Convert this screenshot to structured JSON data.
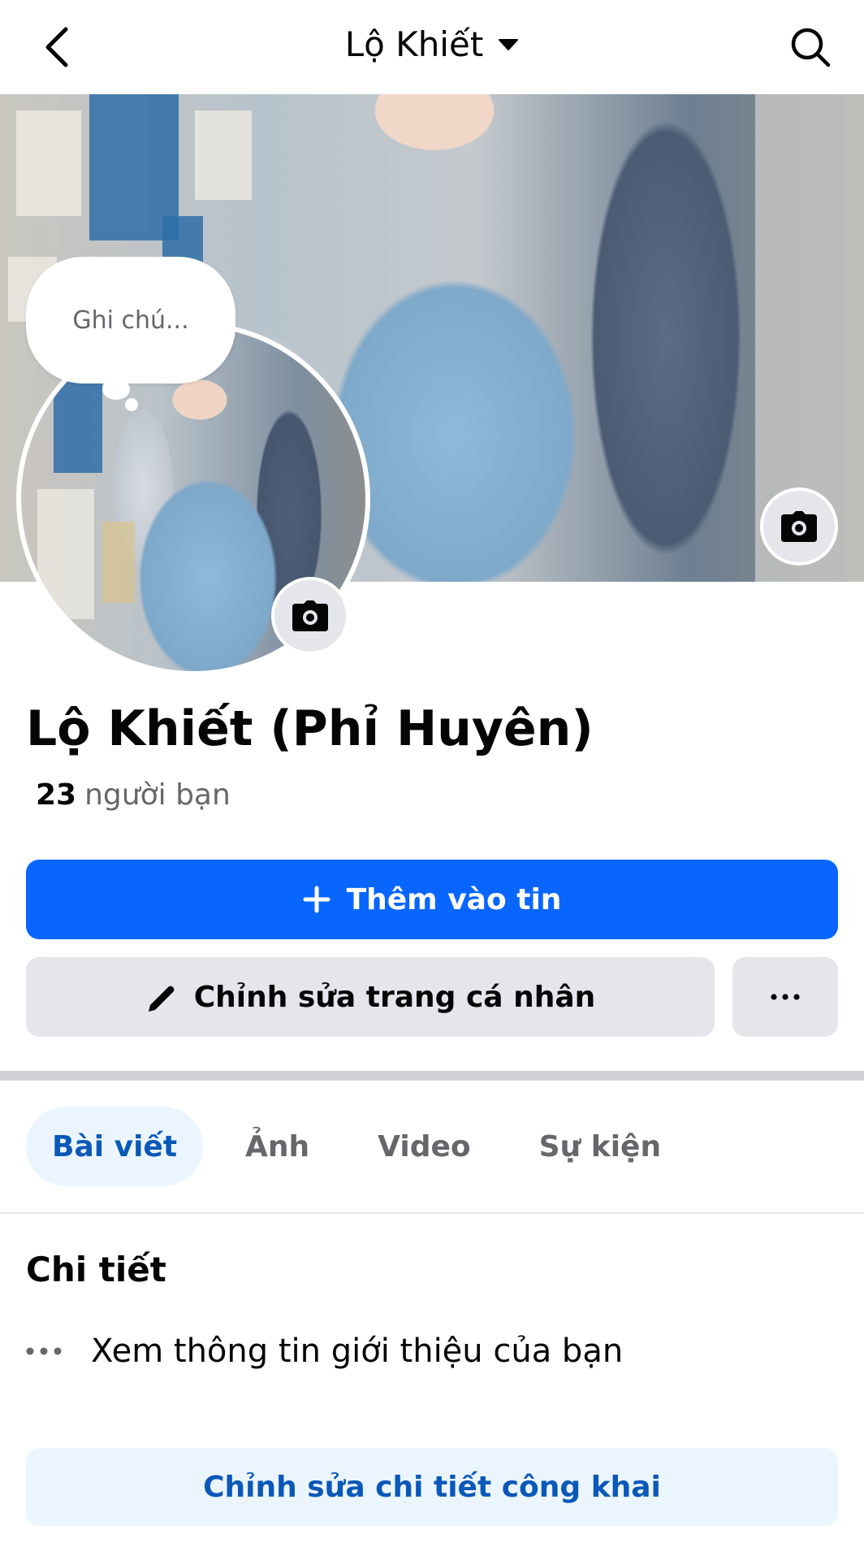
{
  "header": {
    "title": "Lộ Khiết",
    "icons": {
      "back": "chevron-left-icon",
      "dropdown": "caret-down-icon",
      "search": "search-icon"
    }
  },
  "note": {
    "placeholder": "Ghi chú..."
  },
  "profile": {
    "name": "Lộ Khiết (Phỉ Huyên)",
    "friend_count": "23",
    "friend_label": "người bạn"
  },
  "actions": {
    "add_story": "Thêm vào tin",
    "edit_profile": "Chỉnh sửa trang cá nhân",
    "more": "more-icon"
  },
  "tabs": [
    {
      "label": "Bài viết",
      "active": true
    },
    {
      "label": "Ảnh",
      "active": false
    },
    {
      "label": "Video",
      "active": false
    },
    {
      "label": "Sự kiện",
      "active": false
    }
  ],
  "details": {
    "title": "Chi tiết",
    "intro_link": "Xem thông tin giới thiệu của bạn",
    "edit_public": "Chỉnh sửa chi tiết công khai"
  },
  "colors": {
    "primary": "#0866ff",
    "secondary_bg": "#e4e6eb",
    "accent_light": "#ebf5ff",
    "accent_text": "#0a58b8",
    "muted_text": "#65676b"
  }
}
